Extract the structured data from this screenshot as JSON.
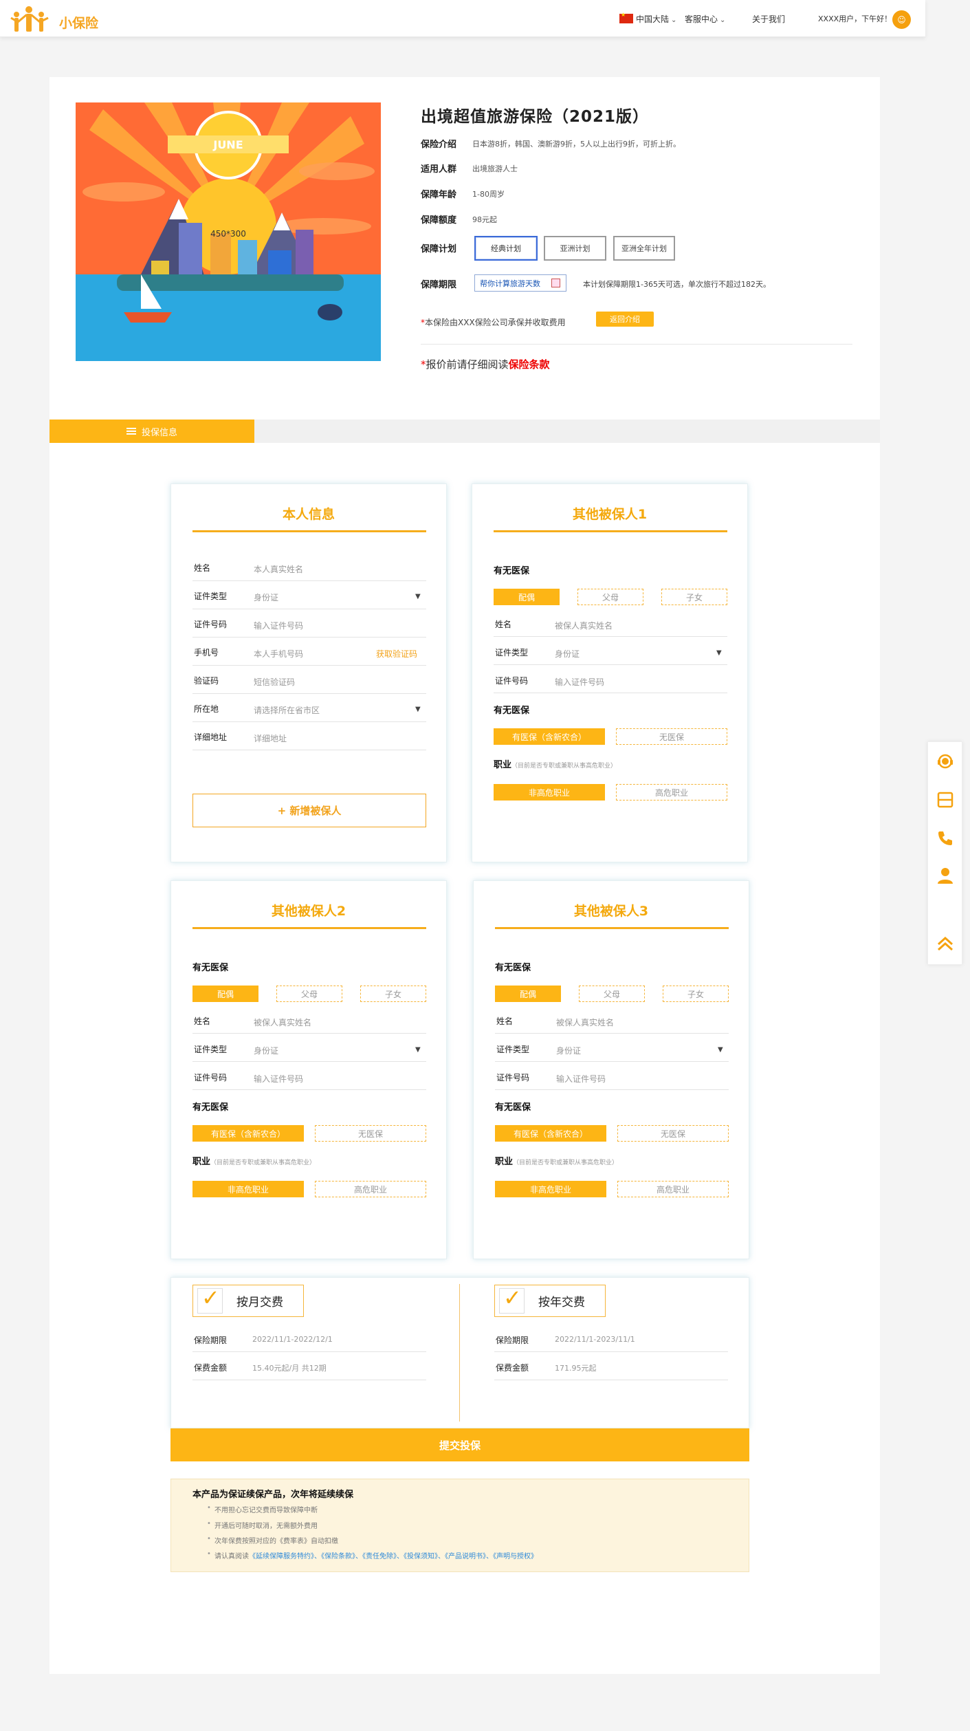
{
  "header": {
    "brand": "小保险",
    "region": "中国大陆",
    "service": "客服中心",
    "about": "关于我们",
    "greeting": "XXXX用户，下午好！"
  },
  "product": {
    "image_placeholder": "450*300",
    "image_badge": "JUNE",
    "title": "出境超值旅游保险（2021版）",
    "rows": [
      {
        "label": "保险介绍",
        "value": "日本游8折，韩国、澳新游9折，5人以上出行9折，可折上折。"
      },
      {
        "label": "适用人群",
        "value": "出境旅游人士"
      },
      {
        "label": "保障年龄",
        "value": "1-80周岁"
      },
      {
        "label": "保障额度",
        "value": "98元起"
      }
    ],
    "plan_label": "保障计划",
    "plans": [
      "经典计划",
      "亚洲计划",
      "亚洲全年计划"
    ],
    "period_label": "保障期限",
    "calc_button": "帮你计算旅游天数",
    "period_note": "本计划保障期限1-365天可选，单次旅行不超过182天。",
    "underwriter_star": "*",
    "underwriter": "本保险由XXX保险公司承保并收取费用",
    "back_button": "返回介绍",
    "warning_star": "*",
    "warning_text": "报价前请仔细阅读",
    "warning_link": "保险条款"
  },
  "section_tab": {
    "label": "投保信息"
  },
  "self_card": {
    "title": "本人信息",
    "fields": [
      {
        "label": "姓名",
        "placeholder": "本人真实姓名"
      },
      {
        "label": "证件类型",
        "placeholder": "身份证"
      },
      {
        "label": "证件号码",
        "placeholder": "输入证件号码"
      },
      {
        "label": "手机号",
        "placeholder": "本人手机号码"
      },
      {
        "label": "验证码",
        "placeholder": "短信验证码"
      },
      {
        "label": "所在地",
        "placeholder": "请选择所在省市区"
      },
      {
        "label": "详细地址",
        "placeholder": "详细地址"
      }
    ],
    "get_code": "获取验证码",
    "add_button": "+ 新增被保人"
  },
  "insured_cards": [
    {
      "title": "其他被保人1"
    },
    {
      "title": "其他被保人2"
    },
    {
      "title": "其他被保人3"
    }
  ],
  "insured_common": {
    "relation_head": "有无医保",
    "relations": [
      "配偶",
      "父母",
      "子女"
    ],
    "name_label": "姓名",
    "name_ph": "被保人真实姓名",
    "idtype_label": "证件类型",
    "idtype_ph": "身份证",
    "idno_label": "证件号码",
    "idno_ph": "输入证件号码",
    "medical_head": "有无医保",
    "medical": [
      "有医保（含新农合）",
      "无医保"
    ],
    "job_head": "职业",
    "job_note": "（目前是否专职或兼职从事高危职业）",
    "jobs": [
      "非高危职业",
      "高危职业"
    ]
  },
  "payment": {
    "monthly": {
      "title": "按月交费",
      "period_label": "保险期限",
      "period": "2022/11/1-2022/12/1",
      "fee_label": "保费金额",
      "fee": "15.40元起/月 共12期"
    },
    "yearly": {
      "title": "按年交费",
      "period_label": "保险期限",
      "period": "2022/11/1-2023/11/1",
      "fee_label": "保费金额",
      "fee": "171.95元起"
    },
    "submit": "提交投保"
  },
  "notice": {
    "title": "本产品为保证续保产品，次年将延续续保",
    "items": [
      "不用担心忘记交费而导致保障中断",
      "开通后可随时取消，无需额外费用",
      "次年保费按照对应的《费率表》自动扣缴"
    ],
    "read_prefix": "请认真阅读",
    "read_links": "《延续保障服务特约》、《保险条款》、《责任免除》、《投保须知》、《产品说明书》、《声明与授权》"
  },
  "colors": {
    "accent": "#fdb515",
    "title": "#f4a90e",
    "warning": "#ee0000",
    "link": "#2f8ad8"
  },
  "sidebar_icons": [
    "headset-icon",
    "cashier-icon",
    "phone-icon",
    "user-icon",
    "back-to-top-icon"
  ]
}
